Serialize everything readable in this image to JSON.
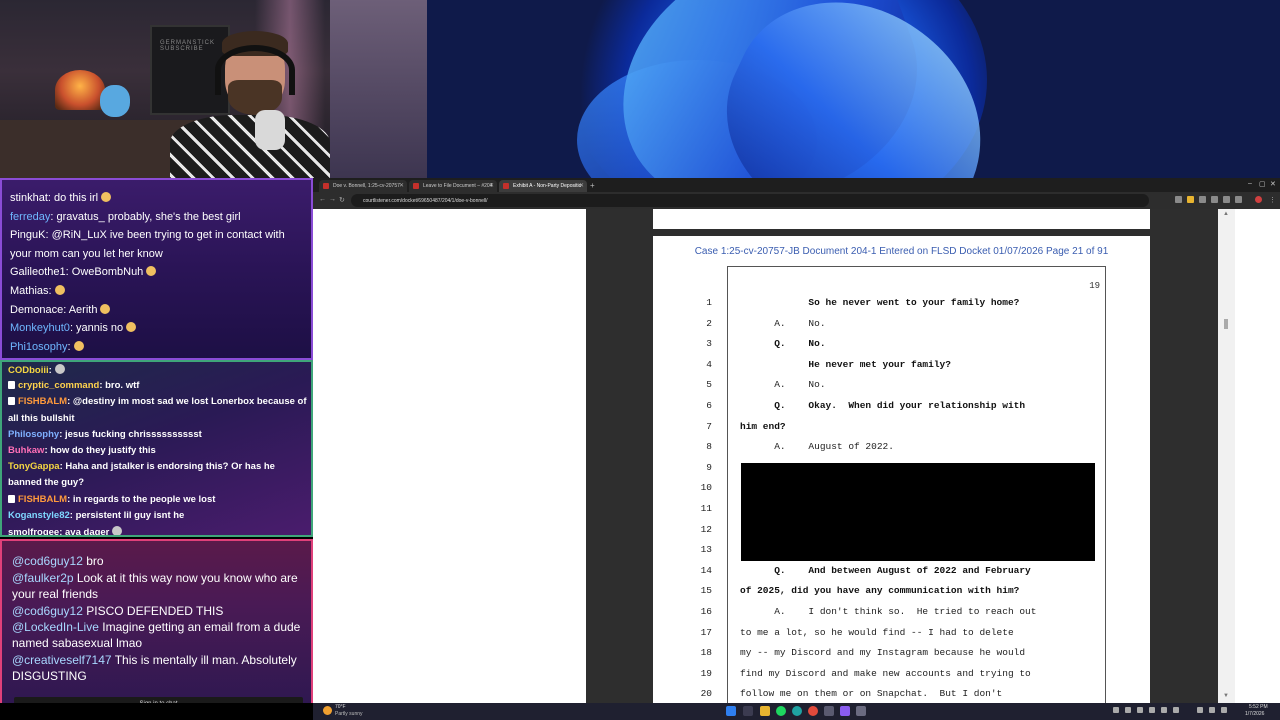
{
  "chat_top": [
    {
      "user": "stinkhat",
      "msg": ": do this irl",
      "user_color": "#ffffff",
      "emote": true
    },
    {
      "user": "ferreday",
      "msg": ": gravatus_ probably, she's the best girl",
      "user_color": "#6fb7ff"
    },
    {
      "user": "PinguK",
      "msg": ": @RiN_LuX ive been trying to get in contact with",
      "user_color": "#ffffff"
    },
    {
      "user": "",
      "msg": "your mom can you let her know",
      "user_color": "#ffffff"
    },
    {
      "user": "Galileothe1",
      "msg": ": OweBombNuh",
      "user_color": "#ffffff",
      "emote": true
    },
    {
      "user": "Mathias",
      "msg": ":",
      "user_color": "#ffffff",
      "emote": true
    },
    {
      "user": "Demonace",
      "msg": ": Aerith",
      "user_color": "#ffffff",
      "emote": true
    },
    {
      "user": "Monkeyhut0",
      "msg": ": yannis no",
      "user_color": "#6fb7ff",
      "emote": true
    },
    {
      "user": "Phi1osophy",
      "msg": ":",
      "user_color": "#6fb7ff",
      "emote": true
    }
  ],
  "chat_mid": [
    {
      "user": "CODboiii",
      "msg": ":",
      "user_color": "#f5d742",
      "badge": false,
      "emote": true
    },
    {
      "user": "cryptic_command",
      "msg": ": bro. wtf",
      "user_color": "#ffd34d",
      "badge": true
    },
    {
      "user": "FISHBALM",
      "msg": ": @destiny im most sad we lost Lonerbox because of",
      "user_color": "#ff9a3c",
      "badge": true
    },
    {
      "user": "",
      "msg": "all this bullshit",
      "user_color": "#ffffff",
      "badge": false
    },
    {
      "user": "Philosophy",
      "msg": ": jesus fucking chrisssssssssst",
      "user_color": "#7fb0ff",
      "badge": false
    },
    {
      "user": "Buhkaw",
      "msg": ": how do they justify this",
      "user_color": "#ff6fb7",
      "badge": false
    },
    {
      "user": "TonyGappa",
      "msg": ": Haha and jstalker is endorsing this? Or has he",
      "user_color": "#f5d742",
      "badge": false
    },
    {
      "user": "",
      "msg": "banned the guy?",
      "user_color": "#ffffff",
      "badge": false
    },
    {
      "user": "FISHBALM",
      "msg": ": in regards to the people we lost",
      "user_color": "#ff9a3c",
      "badge": true
    },
    {
      "user": "Koganstyle82",
      "msg": ": persistent lil guy isnt he",
      "user_color": "#7fd7ff",
      "badge": false
    },
    {
      "user": "smolfrogee",
      "msg": ": ava dager",
      "user_color": "#ffffff",
      "badge": false,
      "emote": true
    }
  ],
  "chat_bot": [
    {
      "user": "@cod6guy12",
      "msg": " bro"
    },
    {
      "user": "@faulker2p",
      "msg": " Look at it this way now you know who are your real friends"
    },
    {
      "user": "@cod6guy12",
      "msg": " PISCO DEFENDED THIS"
    },
    {
      "user": "@LockedIn-Live",
      "msg": " Imagine getting an email from a dude named sabasexual lmao"
    },
    {
      "user": "@creativeself7147",
      "msg": " This is mentally ill man. Absolutely DISGUSTING"
    }
  ],
  "chat_bot_user_color": "#a8d8ff",
  "signin_label": "Sign in to chat",
  "browser": {
    "tabs": [
      {
        "label": "Doe v. Bonnell, 1:25-cv-20757",
        "active": false
      },
      {
        "label": "Leave to File Document – #204",
        "active": false
      },
      {
        "label": "Exhibit A - Non-Party Depositio",
        "active": true
      }
    ],
    "new_tab": "+",
    "url": "courtlistener.com/docket/69650487/204/1/doe-v-bonnell/",
    "win_min": "–",
    "win_max": "▢",
    "win_close": "✕"
  },
  "document": {
    "header": "Case 1:25-cv-20757-JB   Document 204-1   Entered on FLSD Docket 01/07/2026   Page 21 of 91",
    "page_number": "19",
    "lines": [
      {
        "n": "1",
        "text": "            So he never went to your family home?",
        "bold": true
      },
      {
        "n": "2",
        "text": "      A.    No.",
        "bold": false
      },
      {
        "n": "3",
        "text": "      Q.    No.",
        "bold": true
      },
      {
        "n": "4",
        "text": "            He never met your family?",
        "bold": true
      },
      {
        "n": "5",
        "text": "      A.    No.",
        "bold": false
      },
      {
        "n": "6",
        "text": "      Q.    Okay.  When did your relationship with",
        "bold": true
      },
      {
        "n": "7",
        "text": "him end?",
        "bold": true
      },
      {
        "n": "8",
        "text": "      A.    August of 2022.",
        "bold": false
      },
      {
        "n": "9",
        "text": "",
        "bold": false
      },
      {
        "n": "10",
        "text": "",
        "bold": false
      },
      {
        "n": "11",
        "text": "",
        "bold": false
      },
      {
        "n": "12",
        "text": "",
        "bold": false
      },
      {
        "n": "13",
        "text": "",
        "bold": false
      },
      {
        "n": "14",
        "text": "      Q.    And between August of 2022 and February",
        "bold": true
      },
      {
        "n": "15",
        "text": "of 2025, did you have any communication with him?",
        "bold": true
      },
      {
        "n": "16",
        "text": "      A.    I don't think so.  He tried to reach out",
        "bold": false
      },
      {
        "n": "17",
        "text": "to me a lot, so he would find -- I had to delete",
        "bold": false
      },
      {
        "n": "18",
        "text": "my -- my Discord and my Instagram because he would",
        "bold": false
      },
      {
        "n": "19",
        "text": "find my Discord and make new accounts and trying to",
        "bold": false
      },
      {
        "n": "20",
        "text": "follow me on them or on Snapchat.  But I don't",
        "bold": false
      }
    ]
  },
  "taskbar": {
    "weather_temp": "70°F",
    "weather_desc": "Partly sunny",
    "time": "5:52 PM",
    "date": "1/7/2026"
  },
  "webcam_wall_text": "GERMANSTICK\nSUBSCRIBE"
}
